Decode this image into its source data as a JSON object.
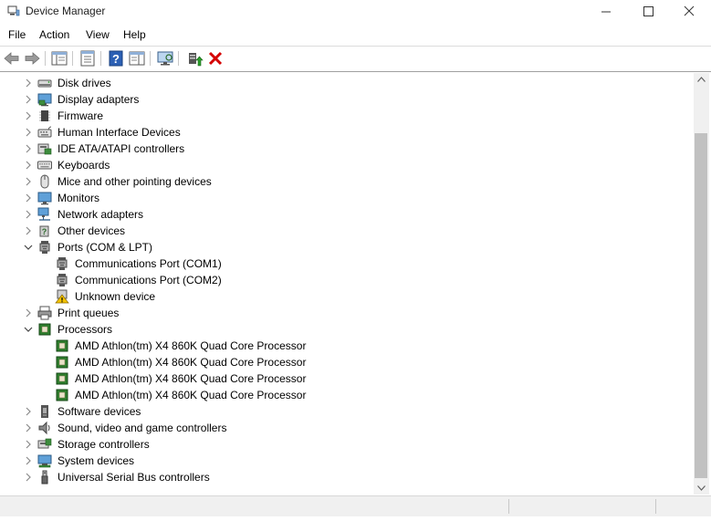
{
  "window": {
    "title": "Device Manager",
    "app_icon": "device-manager-icon",
    "controls": [
      "minimize",
      "maximize",
      "close"
    ]
  },
  "menu": {
    "items": [
      "File",
      "Action",
      "View",
      "Help"
    ]
  },
  "toolbar": {
    "buttons": [
      {
        "name": "back-icon"
      },
      {
        "name": "forward-icon"
      },
      {
        "name": "show-hide-console-tree-icon"
      },
      {
        "name": "properties-icon"
      },
      {
        "name": "help-icon"
      },
      {
        "name": "action-pane-icon"
      },
      {
        "name": "scan-hardware-changes-icon"
      },
      {
        "name": "update-driver-icon"
      },
      {
        "name": "uninstall-device-icon"
      }
    ]
  },
  "tree": {
    "items": [
      {
        "label": "Disk drives",
        "expander": "collapsed",
        "icon": "disk-drive-icon",
        "level": 0
      },
      {
        "label": "Display adapters",
        "expander": "collapsed",
        "icon": "display-adapter-icon",
        "level": 0
      },
      {
        "label": "Firmware",
        "expander": "collapsed",
        "icon": "firmware-icon",
        "level": 0
      },
      {
        "label": "Human Interface Devices",
        "expander": "collapsed",
        "icon": "hid-icon",
        "level": 0
      },
      {
        "label": "IDE ATA/ATAPI controllers",
        "expander": "collapsed",
        "icon": "ide-controller-icon",
        "level": 0
      },
      {
        "label": "Keyboards",
        "expander": "collapsed",
        "icon": "keyboard-icon",
        "level": 0
      },
      {
        "label": "Mice and other pointing devices",
        "expander": "collapsed",
        "icon": "mouse-icon",
        "level": 0
      },
      {
        "label": "Monitors",
        "expander": "collapsed",
        "icon": "monitor-icon",
        "level": 0
      },
      {
        "label": "Network adapters",
        "expander": "collapsed",
        "icon": "network-adapter-icon",
        "level": 0
      },
      {
        "label": "Other devices",
        "expander": "collapsed",
        "icon": "other-devices-icon",
        "level": 0
      },
      {
        "label": "Ports (COM & LPT)",
        "expander": "expanded",
        "icon": "port-icon",
        "level": 0
      },
      {
        "label": "Communications Port (COM1)",
        "expander": "none",
        "icon": "port-icon",
        "level": 1
      },
      {
        "label": "Communications Port (COM2)",
        "expander": "none",
        "icon": "port-icon",
        "level": 1
      },
      {
        "label": "Unknown device",
        "expander": "none",
        "icon": "warning-device-icon",
        "level": 1
      },
      {
        "label": "Print queues",
        "expander": "collapsed",
        "icon": "printer-icon",
        "level": 0
      },
      {
        "label": "Processors",
        "expander": "expanded",
        "icon": "processor-icon",
        "level": 0
      },
      {
        "label": "AMD Athlon(tm) X4 860K Quad Core Processor",
        "expander": "none",
        "icon": "processor-icon",
        "level": 1
      },
      {
        "label": "AMD Athlon(tm) X4 860K Quad Core Processor",
        "expander": "none",
        "icon": "processor-icon",
        "level": 1
      },
      {
        "label": "AMD Athlon(tm) X4 860K Quad Core Processor",
        "expander": "none",
        "icon": "processor-icon",
        "level": 1
      },
      {
        "label": "AMD Athlon(tm) X4 860K Quad Core Processor",
        "expander": "none",
        "icon": "processor-icon",
        "level": 1
      },
      {
        "label": "Software devices",
        "expander": "collapsed",
        "icon": "software-device-icon",
        "level": 0
      },
      {
        "label": "Sound, video and game controllers",
        "expander": "collapsed",
        "icon": "speaker-icon",
        "level": 0
      },
      {
        "label": "Storage controllers",
        "expander": "collapsed",
        "icon": "storage-controller-icon",
        "level": 0
      },
      {
        "label": "System devices",
        "expander": "collapsed",
        "icon": "system-device-icon",
        "level": 0
      },
      {
        "label": "Universal Serial Bus controllers",
        "expander": "collapsed",
        "icon": "usb-icon",
        "level": 0
      }
    ]
  },
  "colors": {
    "accent": "#1e5aa8",
    "uninstall": "#d40000",
    "processor": "#2d7f2d"
  }
}
